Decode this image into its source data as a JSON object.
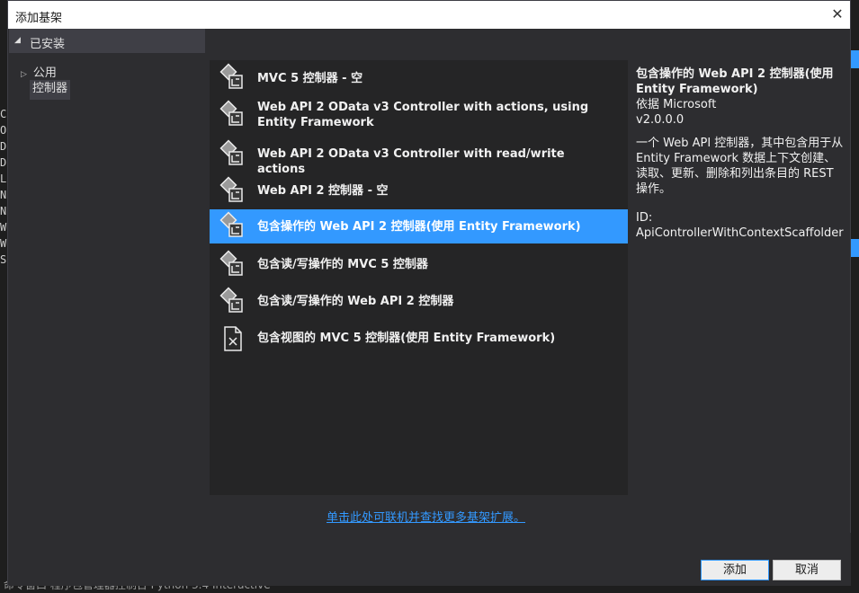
{
  "dialog": {
    "title": "添加基架",
    "close_glyph": "✕"
  },
  "tree": {
    "installed_label": "已安装",
    "public_label": "公用",
    "controller_label": "控制器"
  },
  "list": {
    "items": [
      {
        "label": "MVC 5 控制器 - 空",
        "icon": "controller-icon"
      },
      {
        "label": "Web API 2 OData v3 Controller with actions, using Entity Framework",
        "icon": "controller-icon"
      },
      {
        "label": "Web API 2 OData v3 Controller with read/write actions",
        "icon": "controller-icon"
      },
      {
        "label": "Web API 2 控制器 - 空",
        "icon": "controller-icon"
      },
      {
        "label": "包含操作的 Web API 2 控制器(使用 Entity Framework)",
        "icon": "controller-icon",
        "selected": true
      },
      {
        "label": "包含读/写操作的 MVC 5 控制器",
        "icon": "controller-icon"
      },
      {
        "label": "包含读/写操作的 Web API 2 控制器",
        "icon": "controller-icon"
      },
      {
        "label": "包含视图的 MVC 5 控制器(使用 Entity Framework)",
        "icon": "view-controller-icon"
      }
    ]
  },
  "details": {
    "name": "包含操作的 Web API 2 控制器(使用 Entity Framework)",
    "author": "依据 Microsoft",
    "version": "v2.0.0.0",
    "description": "一个 Web API 控制器，其中包含用于从 Entity Framework 数据上下文创建、读取、更新、删除和列出条目的 REST 操作。",
    "id": "ID: ApiControllerWithContextScaffolder"
  },
  "more_link": "单击此处可联机并查找更多基架扩展。",
  "buttons": {
    "add": "添加",
    "cancel": "取消"
  },
  "background": {
    "status_text": "命令窗口   程序包管理器控制台   Python 3.4 Interactive",
    "accent_color": "#3399ff"
  }
}
